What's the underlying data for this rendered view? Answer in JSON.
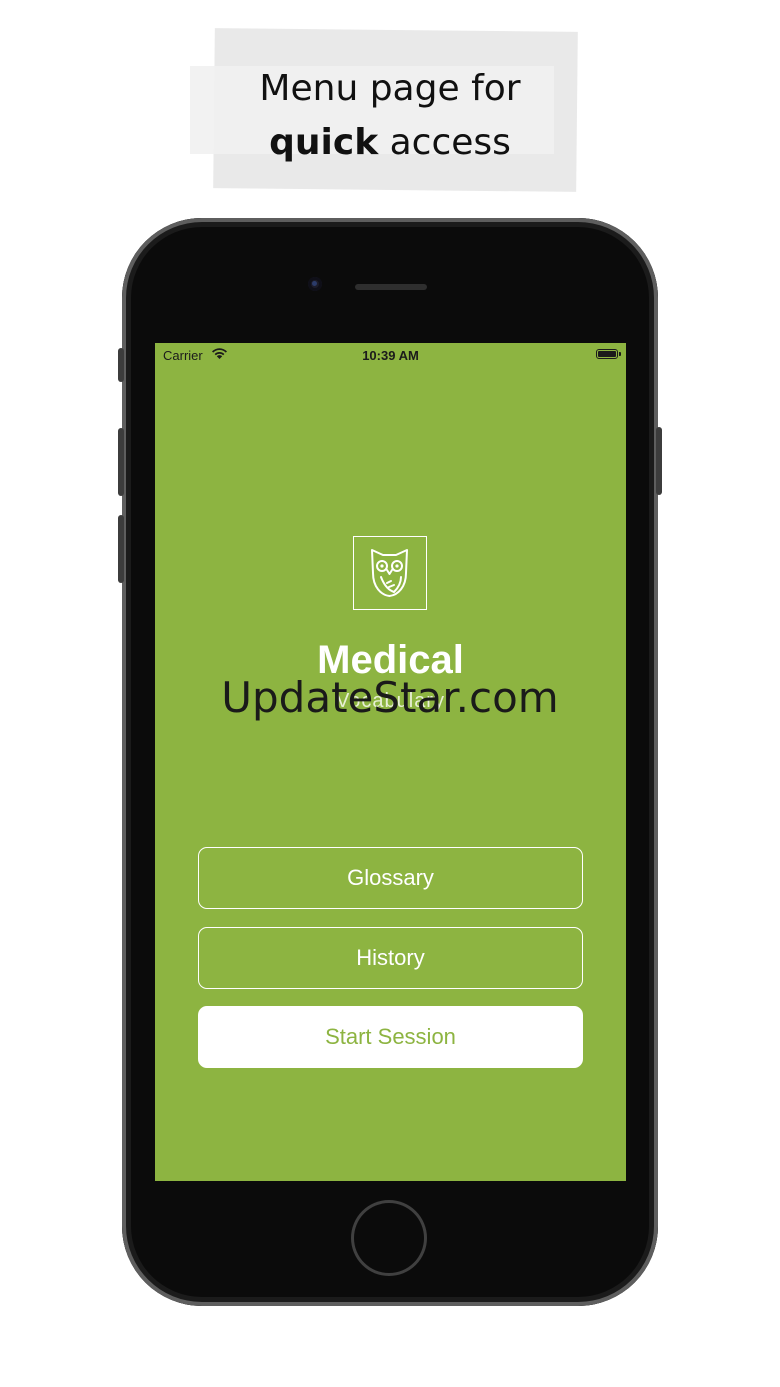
{
  "caption": {
    "line1": "Menu page for",
    "line2_bold": "quick",
    "line2_rest": " access"
  },
  "status_bar": {
    "carrier": "Carrier",
    "time": "10:39 AM"
  },
  "app": {
    "logo_icon": "owl-icon",
    "title": "Medical",
    "subtitle": "Vocabulary"
  },
  "menu": {
    "glossary_label": "Glossary",
    "history_label": "History",
    "start_session_label": "Start Session"
  },
  "watermark": "UpdateStar.com",
  "colors": {
    "accent_green": "#8db441",
    "button_text_white": "#ffffff"
  }
}
